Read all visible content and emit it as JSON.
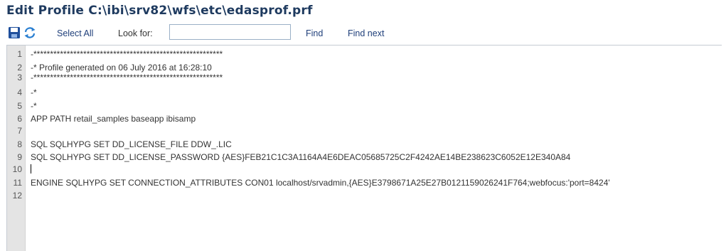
{
  "window": {
    "title": "Edit Profile C:\\ibi\\srv82\\wfs\\etc\\edasprof.prf"
  },
  "toolbar": {
    "save_icon": "save-disk-icon",
    "refresh_icon": "refresh-icon",
    "select_all_label": "Select All",
    "look_for_label": "Look for:",
    "search_value": "",
    "find_label": "Find",
    "find_next_label": "Find next"
  },
  "editor": {
    "line_numbers": [
      "1",
      "2",
      "3",
      "4",
      "5",
      "6",
      "7",
      "8",
      "9",
      "10",
      "11",
      "12"
    ],
    "lines": [
      "-*********************************************************",
      "-* Profile generated on 06 July 2016 at 16:28:10",
      "-*********************************************************",
      "-*",
      "-*",
      "APP PATH retail_samples baseapp ibisamp",
      "",
      "SQL SQLHYPG SET DD_LICENSE_FILE DDW_.LIC",
      "SQL SQLHYPG SET DD_LICENSE_PASSWORD {AES}FEB21C1C3A1164A4E6DEAC05685725C2F4242AE14BE238623C6052E12E340A84",
      "",
      "ENGINE SQLHYPG SET CONNECTION_ATTRIBUTES CON01 localhost/srvadmin,{AES}E3798671A25E27B0121159026241F764;webfocus:'port=8424'",
      ""
    ]
  },
  "colors": {
    "title": "#1e3a5f",
    "toolbar_link": "#1f3f7a",
    "gutter_bg": "#e4e4e4",
    "save_icon": "#1f4f9c",
    "refresh_icon": "#2a7fd1"
  }
}
